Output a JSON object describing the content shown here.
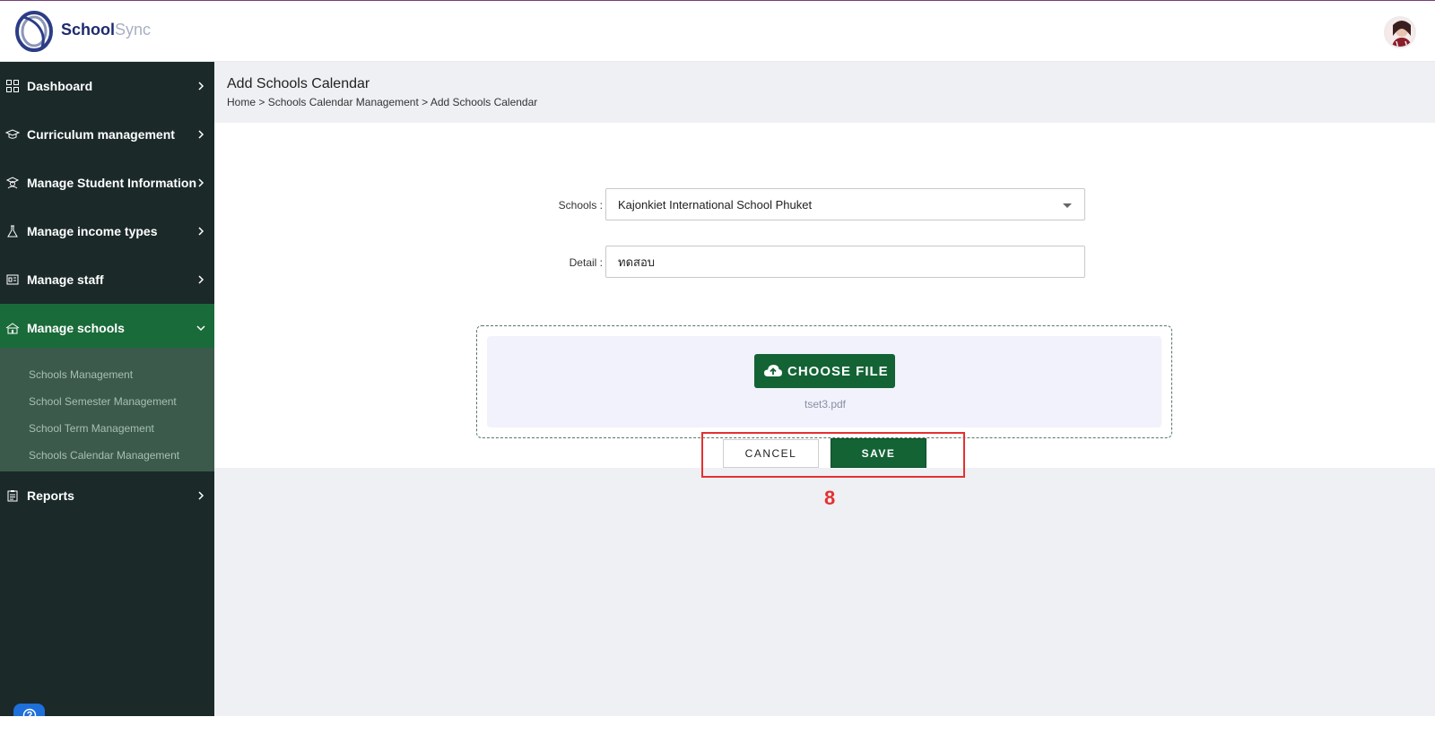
{
  "app": {
    "brand_bold": "School",
    "brand_light": "Sync"
  },
  "colors": {
    "accent": "#136334",
    "sidebar_bg": "#1b2929",
    "active_nav": "#1a6b3a",
    "highlight": "#e53030"
  },
  "sidebar": {
    "items": [
      {
        "label": "Dashboard",
        "icon": "grid-icon"
      },
      {
        "label": "Curriculum management",
        "icon": "graduation-cap-icon"
      },
      {
        "label": "Manage Student Information",
        "icon": "student-icon"
      },
      {
        "label": "Manage income types",
        "icon": "flask-icon"
      },
      {
        "label": "Manage staff",
        "icon": "id-card-icon"
      },
      {
        "label": "Manage schools",
        "icon": "school-icon",
        "active": true
      },
      {
        "label": "Reports",
        "icon": "clipboard-icon"
      }
    ],
    "submenu": [
      "Schools Management",
      "School Semester Management",
      "School Term Management",
      "Schools Calendar Management"
    ]
  },
  "page": {
    "title": "Add Schools Calendar",
    "breadcrumb": [
      "Home",
      "Schools Calendar Management",
      "Add Schools Calendar"
    ],
    "separator": ">"
  },
  "form": {
    "schools_label": "Schools :",
    "schools_value": "Kajonkiet International School Phuket",
    "detail_label": "Detail :",
    "detail_value": "ทดสอบ",
    "choose_file_label": "CHOOSE FILE",
    "file_name": "tset3.pdf",
    "cancel_label": "CANCEL",
    "save_label": "SAVE"
  },
  "annotation": {
    "step_number": "8"
  }
}
